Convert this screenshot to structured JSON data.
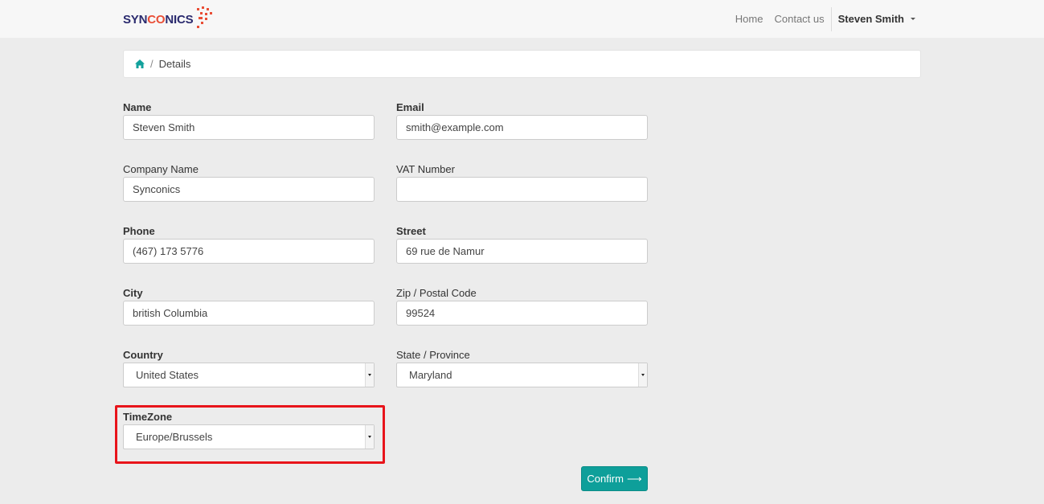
{
  "brand": {
    "name_part1": "SYN",
    "name_part2": "CO",
    "name_part3": "NICS",
    "accent_color": "#e94e36",
    "text_color": "#2a2a6e"
  },
  "nav": {
    "home": "Home",
    "contact": "Contact us",
    "user": "Steven Smith"
  },
  "breadcrumb": {
    "icon": "home-icon",
    "separator": "/",
    "current": "Details"
  },
  "form": {
    "name": {
      "label": "Name",
      "value": "Steven Smith"
    },
    "email": {
      "label": "Email",
      "value": "smith@example.com"
    },
    "company": {
      "label": "Company Name",
      "value": "Synconics"
    },
    "vat": {
      "label": "VAT Number",
      "value": ""
    },
    "phone": {
      "label": "Phone",
      "value": "(467) 173 5776"
    },
    "street": {
      "label": "Street",
      "value": "69 rue de Namur"
    },
    "city": {
      "label": "City",
      "value": "british Columbia"
    },
    "zip": {
      "label": "Zip / Postal Code",
      "value": "99524"
    },
    "country": {
      "label": "Country",
      "value": "United States"
    },
    "state": {
      "label": "State / Province",
      "value": "Maryland"
    },
    "timezone": {
      "label": "TimeZone",
      "value": "Europe/Brussels"
    }
  },
  "confirm": {
    "label": "Confirm",
    "arrow": "⟶"
  },
  "colors": {
    "primary": "#0e9f9a",
    "highlight": "#e8141b",
    "background": "#ececec"
  }
}
